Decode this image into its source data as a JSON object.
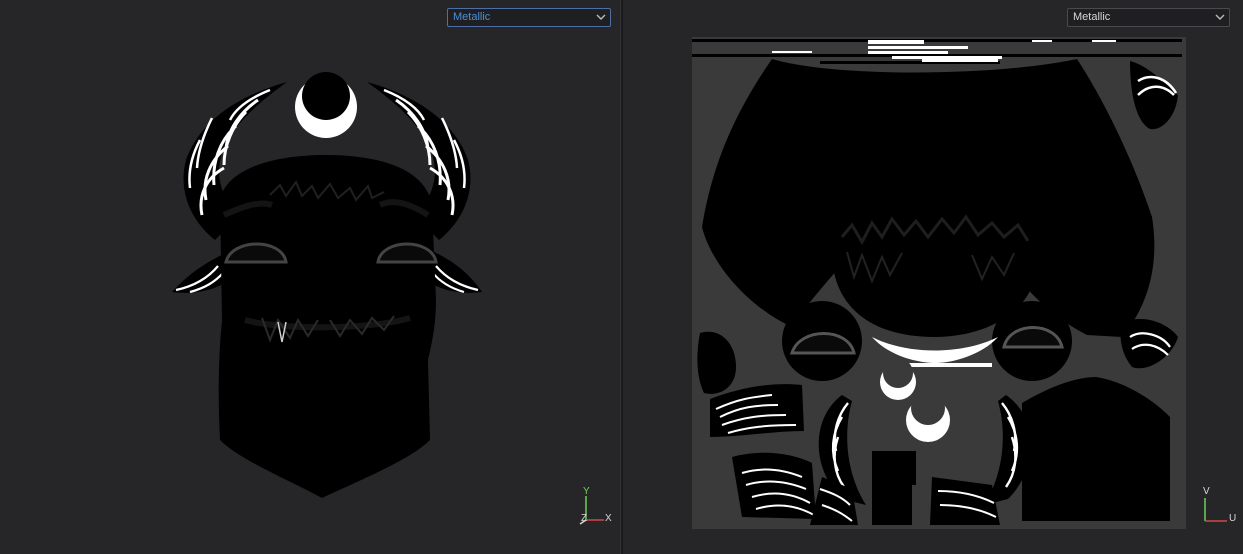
{
  "viewport_3d": {
    "channel_select": {
      "value": "Metallic",
      "options": [
        "Metallic"
      ]
    },
    "axes": {
      "up": "Y",
      "right": "X",
      "depth": "Z"
    }
  },
  "viewport_2d": {
    "channel_select": {
      "value": "Metallic",
      "options": [
        "Metallic"
      ]
    },
    "axes": {
      "up": "V",
      "right": "U"
    }
  },
  "colors": {
    "background": "#262628",
    "uv_canvas": "#3a3a3a",
    "accent_blue": "#4a8fe0",
    "axis_x": "#d04848",
    "axis_y": "#6fcf5a",
    "axis_z": "#d8d8d8"
  }
}
